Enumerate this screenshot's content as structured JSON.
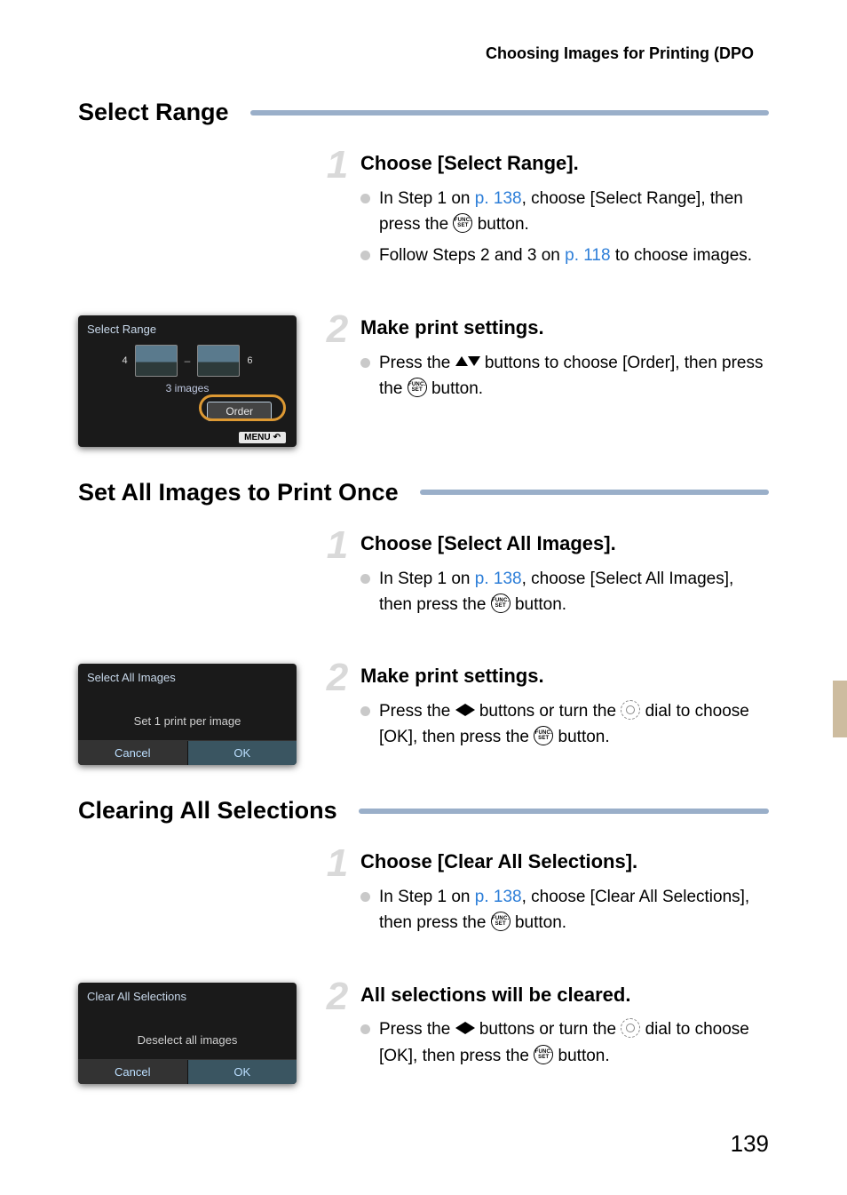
{
  "header_title": "Choosing Images for Printing (DPOF)",
  "page_number": "139",
  "link1": "p. 138",
  "link2": "p. 118",
  "sec1": {
    "title": "Select Range",
    "step1": {
      "heading": "Choose [Select Range].",
      "text_a": "In Step 1 on ",
      "text_b": ", choose [Select Range], then press the ",
      "text_c": " button.",
      "text2_a": "Follow Steps 2 and 3 on ",
      "text2_b": " to choose images."
    },
    "step2": {
      "heading": "Make print settings.",
      "text_a": "Press the ",
      "text_b": " buttons to choose [Order], then press the ",
      "text_c": " button."
    },
    "screen": {
      "title": "Select Range",
      "num_left": "4",
      "num_right": "6",
      "count": "3 images",
      "order": "Order",
      "menu": "MENU"
    }
  },
  "sec2": {
    "title": "Set All Images to Print Once",
    "step1": {
      "heading": "Choose [Select All Images].",
      "text_a": "In Step 1 on ",
      "text_b": ", choose [Select All Images], then press the ",
      "text_c": " button."
    },
    "step2": {
      "heading": "Make print settings.",
      "text_a": "Press the ",
      "text_b": " buttons or turn the ",
      "text_c": " dial to choose [OK], then press the ",
      "text_d": " button."
    },
    "screen": {
      "title": "Select All Images",
      "msg": "Set 1 print per image",
      "cancel": "Cancel",
      "ok": "OK"
    }
  },
  "sec3": {
    "title": "Clearing All Selections",
    "step1": {
      "heading": "Choose [Clear All Selections].",
      "text_a": "In Step 1 on ",
      "text_b": ", choose [Clear All Selections], then press the ",
      "text_c": " button."
    },
    "step2": {
      "heading": "All selections will be cleared.",
      "text_a": "Press the ",
      "text_b": " buttons or turn the ",
      "text_c": " dial to choose [OK], then press the ",
      "text_d": " button."
    },
    "screen": {
      "title": "Clear All Selections",
      "msg": "Deselect all images",
      "cancel": "Cancel",
      "ok": "OK"
    }
  },
  "funcset_top": "FUNC.",
  "funcset_bot": "SET"
}
